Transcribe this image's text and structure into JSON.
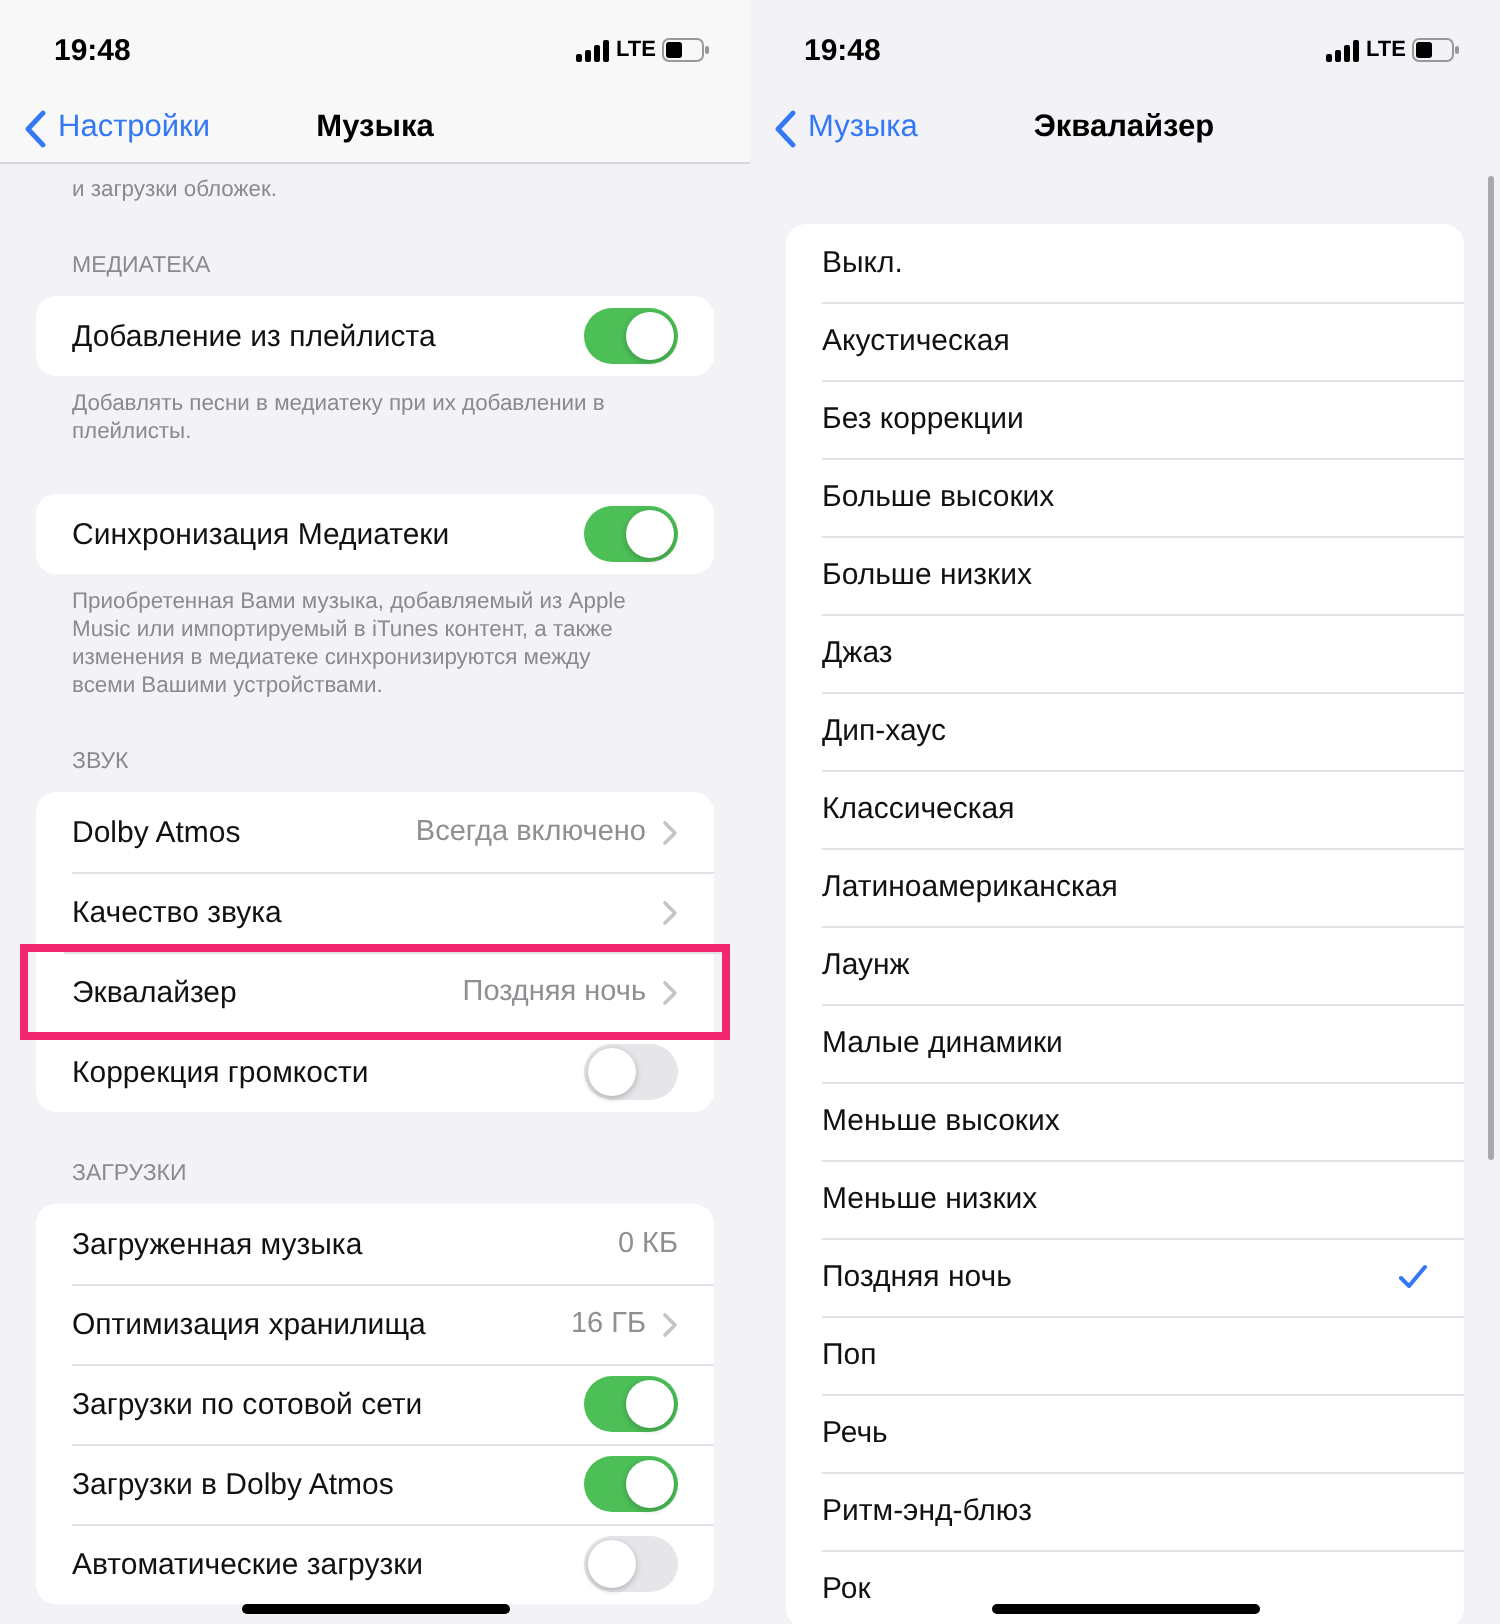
{
  "screens": [
    {
      "status": {
        "time": "19:48",
        "network": "LTE"
      },
      "nav": {
        "back": "Настройки",
        "title": "Музыка"
      },
      "kind": "settings",
      "sections": [
        {
          "footer": "и загрузки обложек."
        },
        {
          "header": "МЕДИАТЕКА",
          "rows": [
            {
              "kind": "toggle",
              "label": "Добавление из плейлиста",
              "on": true
            }
          ],
          "footer": "Добавлять песни в медиатеку при их добавлении в плейлисты."
        },
        {
          "rows": [
            {
              "kind": "toggle",
              "label": "Синхронизация Медиатеки",
              "on": true
            }
          ],
          "footer": "Приобретенная Вами музыка, добавляемый из Apple Music или импортируемый в iTunes контент, а также изменения в медиатеке синхронизируются между всеми Вашими устройствами."
        },
        {
          "header": "ЗВУК",
          "rows": [
            {
              "kind": "link",
              "label": "Dolby Atmos",
              "value": "Всегда включено",
              "highlighted": false
            },
            {
              "kind": "link",
              "label": "Качество звука",
              "highlighted": false
            },
            {
              "kind": "link",
              "label": "Эквалайзер",
              "value": "Поздняя ночь",
              "highlighted": true
            },
            {
              "kind": "toggle",
              "label": "Коррекция громкости",
              "on": false
            }
          ]
        },
        {
          "header": "ЗАГРУЗКИ",
          "rows": [
            {
              "kind": "info",
              "label": "Загруженная музыка",
              "value": "0 КБ"
            },
            {
              "kind": "link",
              "label": "Оптимизация хранилища",
              "value": "16 ГБ",
              "highlighted": false
            },
            {
              "kind": "toggle",
              "label": "Загрузки по сотовой сети",
              "on": true
            },
            {
              "kind": "toggle",
              "label": "Загрузки в Dolby Atmos",
              "on": true
            },
            {
              "kind": "toggle",
              "label": "Автоматические загрузки",
              "on": false
            }
          ]
        }
      ]
    },
    {
      "status": {
        "time": "19:48",
        "network": "LTE"
      },
      "nav": {
        "back": "Музыка",
        "title": "Эквалайзер"
      },
      "kind": "list",
      "sections": [
        {
          "rows": [
            {
              "kind": "option",
              "label": "Выкл.",
              "selected": false
            },
            {
              "kind": "option",
              "label": "Акустическая",
              "selected": false
            },
            {
              "kind": "option",
              "label": "Без коррекции",
              "selected": false
            },
            {
              "kind": "option",
              "label": "Больше высоких",
              "selected": false
            },
            {
              "kind": "option",
              "label": "Больше низких",
              "selected": false
            },
            {
              "kind": "option",
              "label": "Джаз",
              "selected": false
            },
            {
              "kind": "option",
              "label": "Дип-хаус",
              "selected": false
            },
            {
              "kind": "option",
              "label": "Классическая",
              "selected": false
            },
            {
              "kind": "option",
              "label": "Латиноамериканская",
              "selected": false
            },
            {
              "kind": "option",
              "label": "Лаунж",
              "selected": false
            },
            {
              "kind": "option",
              "label": "Малые динамики",
              "selected": false
            },
            {
              "kind": "option",
              "label": "Меньше высоких",
              "selected": false
            },
            {
              "kind": "option",
              "label": "Меньше низких",
              "selected": false
            },
            {
              "kind": "option",
              "label": "Поздняя ночь",
              "selected": true
            },
            {
              "kind": "option",
              "label": "Поп",
              "selected": false
            },
            {
              "kind": "option",
              "label": "Речь",
              "selected": false
            },
            {
              "kind": "option",
              "label": "Ритм-энд-блюз",
              "selected": false
            },
            {
              "kind": "option",
              "label": "Рок",
              "selected": false
            }
          ]
        }
      ]
    }
  ]
}
